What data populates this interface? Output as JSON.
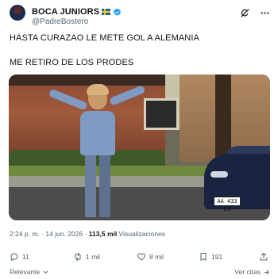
{
  "author": {
    "display_name": "BOCA JUNIORS",
    "handle": "@PadreBostero",
    "flag_icon": "sweden-flag-icon",
    "verified_icon": "verified-badge-icon",
    "verified_color": "#1d9bf0"
  },
  "header_icons": [
    "grok-icon",
    "more-icon"
  ],
  "post": {
    "line1": "HASTA CURAZAO LE METE GOL A ALEMANIA",
    "line2": "ME RETIRO DE LOS PRODES"
  },
  "media": {
    "plate_text": "AA 433 EK"
  },
  "meta": {
    "time": "2:24 p. m.",
    "separator": "·",
    "date": "14 jun. 2026",
    "views_count": "113,5 mil",
    "views_label": "Visualizaciones"
  },
  "actions": {
    "replies": "11",
    "reposts": "1 mil",
    "likes": "8 mil",
    "bookmarks": "191"
  },
  "footer": {
    "sort_label": "Relevante",
    "replies_link": "Ver citas"
  },
  "colors": {
    "text_primary": "#0f1419",
    "text_secondary": "#536471",
    "accent": "#1d9bf0"
  }
}
